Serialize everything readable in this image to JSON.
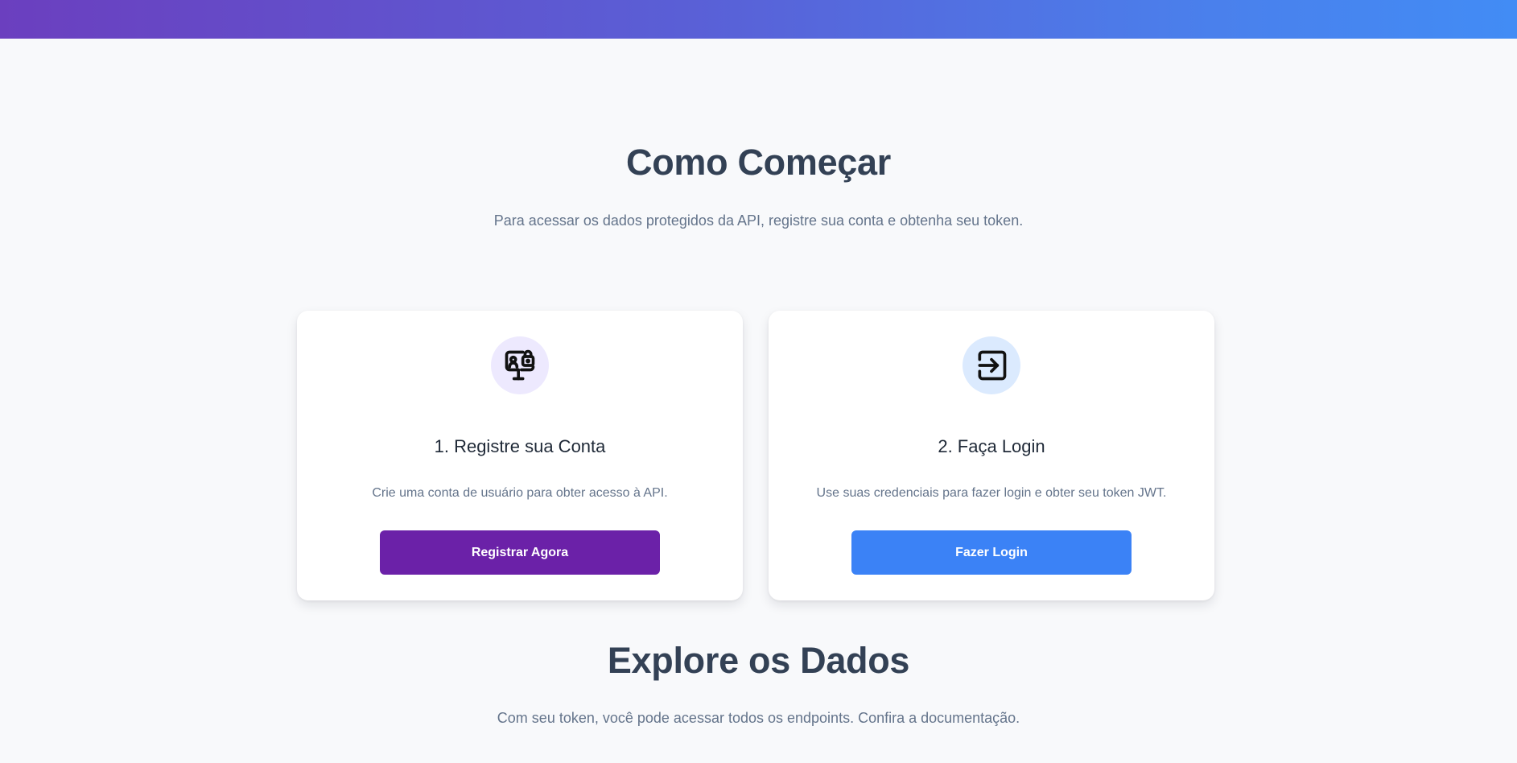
{
  "colors": {
    "primary_purple": "#6b21a8",
    "primary_blue": "#3b82f6",
    "icon_bg_purple": "#ede9fe",
    "icon_bg_blue": "#dbeafe"
  },
  "getting_started": {
    "title": "Como Começar",
    "subtitle": "Para acessar os dados protegidos da API, registre sua conta e obtenha seu token."
  },
  "cards": [
    {
      "icon": "user-lock-monitor-icon",
      "title": "1. Registre sua Conta",
      "description": "Crie uma conta de usuário para obter acesso à API.",
      "button_label": "Registrar Agora"
    },
    {
      "icon": "login-icon",
      "title": "2. Faça Login",
      "description": "Use suas credenciais para fazer login e obter seu token JWT.",
      "button_label": "Fazer Login"
    }
  ],
  "explore": {
    "title": "Explore os Dados",
    "subtitle": "Com seu token, você pode acessar todos os endpoints. Confira a documentação."
  }
}
